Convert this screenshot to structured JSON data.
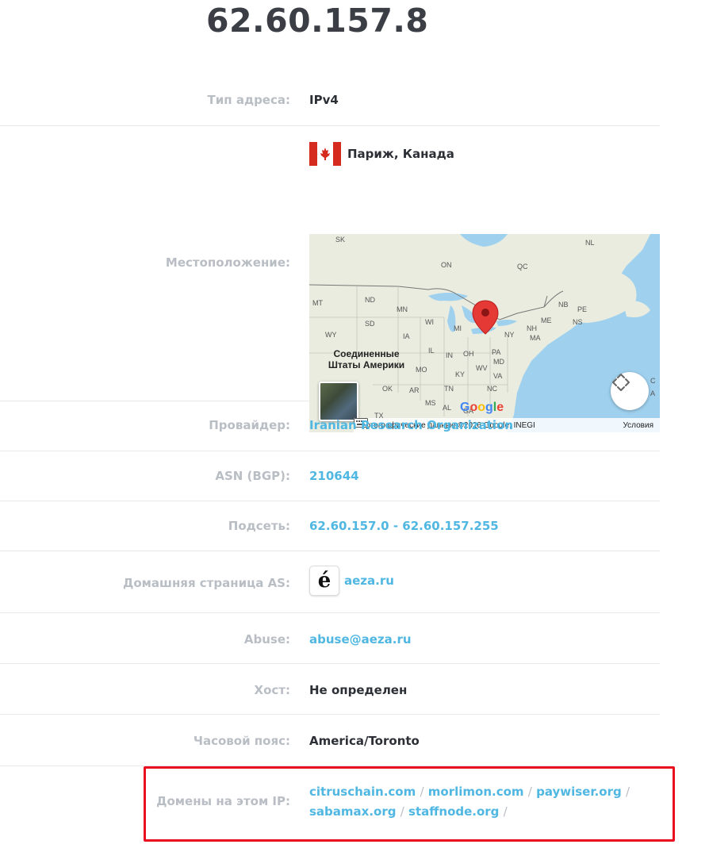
{
  "ip": "62.60.157.8",
  "rows": {
    "type": {
      "label": "Тип адреса:",
      "value": "IPv4"
    },
    "location": {
      "label": "Местоположение:",
      "value": "Париж, Канада",
      "flag": "canada-flag-icon",
      "map": {
        "region_labels": [
          "SK",
          "ON",
          "QC",
          "NL",
          "MT",
          "ND",
          "MN",
          "WI",
          "MI",
          "SD",
          "IA",
          "IL",
          "IN",
          "OH",
          "PA",
          "NY",
          "ME",
          "NB",
          "PE",
          "NS",
          "NH",
          "MA",
          "WY",
          "MO",
          "KY",
          "WV",
          "MD",
          "VA",
          "NC",
          "TN",
          "AR",
          "OK",
          "MS",
          "AL",
          "GA",
          "TX",
          "C",
          "A"
        ],
        "country_label": "Соединенные Штаты Америки",
        "attribution": "Картографические данные ©2026 Google, INEGI",
        "terms": "Условия",
        "logo": "Google",
        "marker_color": "#e53935"
      }
    },
    "provider": {
      "label": "Провайдер:",
      "value": "Iranian Research Organization"
    },
    "asn": {
      "label": "ASN (BGP):",
      "value": "210644"
    },
    "subnet": {
      "label": "Подсеть:",
      "value": "62.60.157.0 - 62.60.157.255"
    },
    "as_home": {
      "label": "Домашняя страница AS:",
      "value": "aeza.ru",
      "icon_glyph": "é"
    },
    "abuse": {
      "label": "Abuse:",
      "value": "abuse@aeza.ru"
    },
    "host": {
      "label": "Хост:",
      "value": "Не определен"
    },
    "timezone": {
      "label": "Часовой пояс:",
      "value": "America/Toronto"
    },
    "domains": {
      "label": "Домены на этом IP:",
      "items": [
        "citruschain.com",
        "morlimon.com",
        "paywiser.org",
        "sabamax.org",
        "staffnode.org"
      ],
      "separator": "/"
    }
  },
  "colors": {
    "link": "#4fb7e1",
    "label": "#b9bec5",
    "value": "#2c3036",
    "highlight": "#e8101e"
  }
}
